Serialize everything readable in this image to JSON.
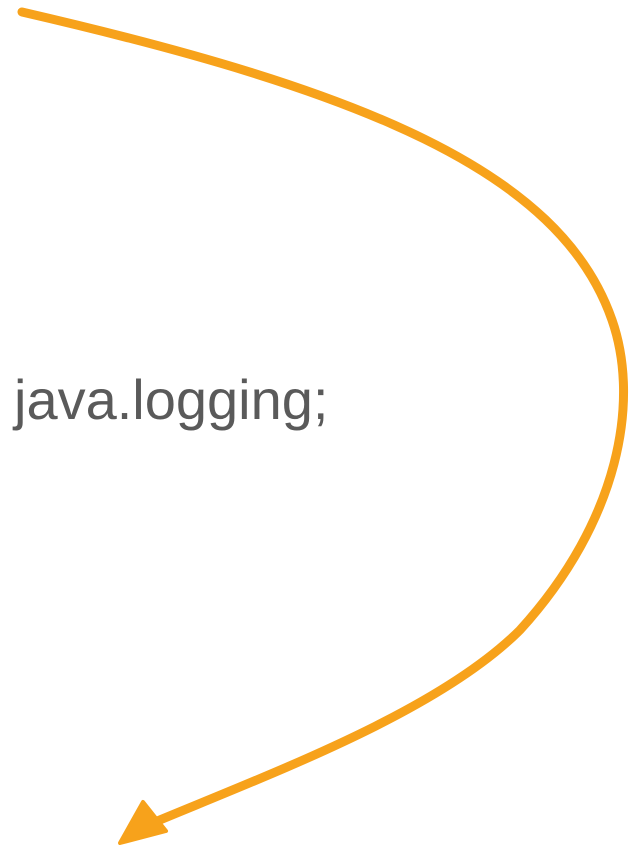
{
  "label": {
    "text": "java.logging;"
  },
  "colors": {
    "arrow": "#F7A21B",
    "text": "#5a5a5a",
    "background": "#ffffff"
  },
  "icons": {
    "arrow": "curved-arrow-icon"
  }
}
